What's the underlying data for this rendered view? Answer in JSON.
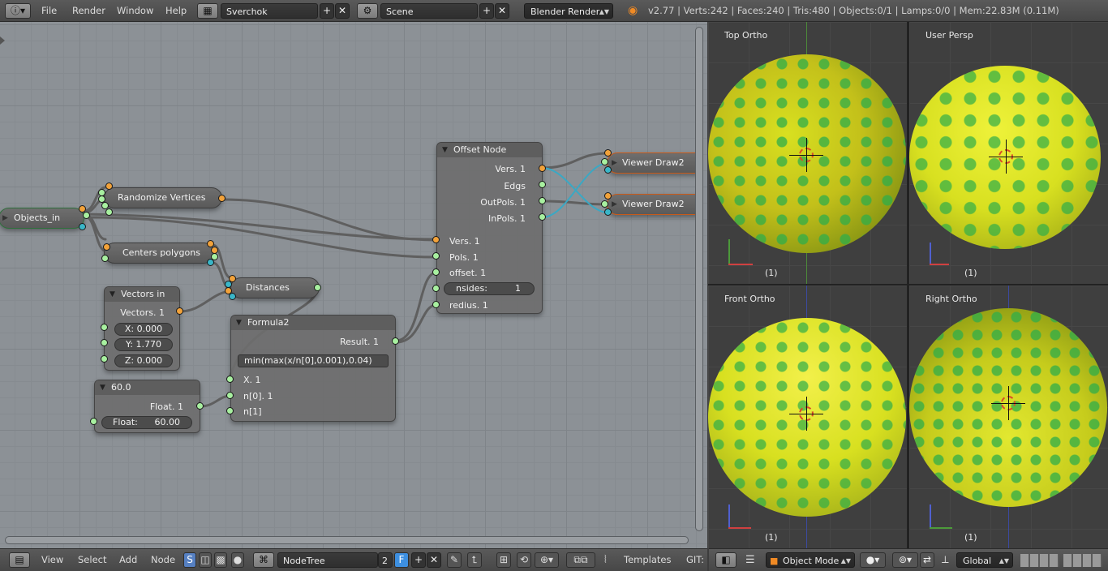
{
  "topbar": {
    "menu": [
      "File",
      "Render",
      "Window",
      "Help"
    ],
    "screen_layout": "Sverchok",
    "scene": "Scene",
    "render_engine": "Blender Render",
    "stats": "v2.77 | Verts:242 | Faces:240 | Tris:480 | Objects:0/1 | Lamps:0/0 | Mem:22.83M (0.11M)"
  },
  "nodes": {
    "objects_in": {
      "label": "Objects_in"
    },
    "randomize": {
      "label": "Randomize Vertices"
    },
    "centers": {
      "label": "Centers polygons"
    },
    "distances": {
      "label": "Distances"
    },
    "vectors_in": {
      "title": "Vectors in",
      "out": "Vectors. 1",
      "x": "X: 0.000",
      "y": "Y: 1.770",
      "z": "Z: 0.000"
    },
    "float_node": {
      "title": "60.0",
      "out": "Float. 1",
      "field_label": "Float:",
      "field_value": "60.00"
    },
    "formula": {
      "title": "Formula2",
      "out": "Result. 1",
      "expr": "min(max(x/n[0],0.001),0.04)",
      "in1": "X. 1",
      "in2": "n[0]. 1",
      "in3": "n[1]"
    },
    "offset": {
      "title": "Offset Node",
      "out1": "Vers. 1",
      "out2": "Edgs",
      "out3": "OutPols. 1",
      "out4": "InPols. 1",
      "in1": "Vers. 1",
      "in2": "Pols. 1",
      "in3": "offset. 1",
      "nsides_label": "nsides:",
      "nsides_value": "1",
      "in5": "redius. 1"
    },
    "viewer1": {
      "label": "Viewer Draw2"
    },
    "viewer2": {
      "label": "Viewer Draw2"
    }
  },
  "nodebar": {
    "menu": [
      "View",
      "Select",
      "Add",
      "Node"
    ],
    "tree_name": "NodeTree",
    "users": "2",
    "fake_user": "F",
    "templates": "Templates",
    "git": "GIT:"
  },
  "viewports": [
    {
      "label": "Top Ortho",
      "count": "(1)"
    },
    {
      "label": "User Persp",
      "count": "(1)"
    },
    {
      "label": "Front Ortho",
      "count": "(1)"
    },
    {
      "label": "Right Ortho",
      "count": "(1)"
    }
  ],
  "viewbar": {
    "mode": "Object Mode",
    "orientation": "Global"
  },
  "colors": {
    "socket_green": "#a8f0a0",
    "socket_orange": "#f2a23a",
    "socket_cyan": "#3ab6c8",
    "mesh_yellow": "#d8e020",
    "mesh_green": "#2fae4a"
  }
}
